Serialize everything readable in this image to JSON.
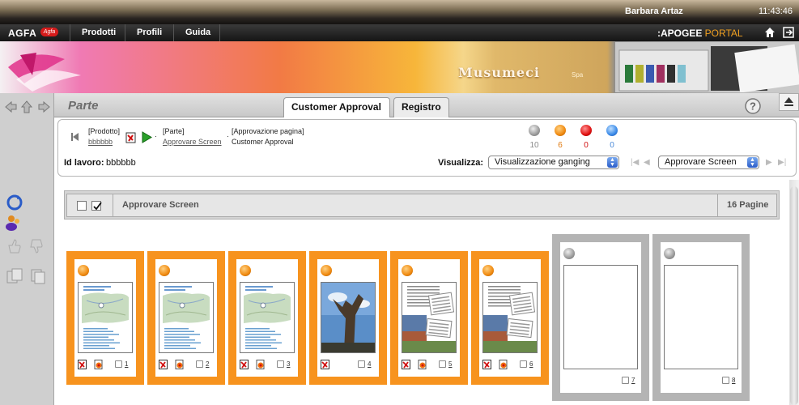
{
  "topbar": {
    "user": "Barbara Artaz",
    "time": "11:43:46"
  },
  "nav": {
    "logo": "AGFA",
    "logo_badge": "Agfa",
    "items": [
      "Prodotti",
      "Profili",
      "Guida"
    ],
    "portal_prefix": ":APOGEE",
    "portal_suffix": " PORTAL"
  },
  "banner": {
    "company": "Musumeci",
    "suffix": "Spa"
  },
  "header": {
    "title": "Parte",
    "tabs": [
      {
        "label": "Customer Approval",
        "active": true
      },
      {
        "label": "Registro",
        "active": false
      }
    ]
  },
  "breadcrumb": {
    "product_label": "[Prodotto]",
    "product_value": "bbbbbb",
    "part_label": "[Parte]",
    "part_value": "Approvare Screen",
    "approval_label": "[Approvazione pagina]",
    "approval_value": "Customer Approval"
  },
  "status_counts": [
    {
      "color": "#9a9a9a",
      "value": "10",
      "text_color": "#8a8a8a"
    },
    {
      "color": "#f08a10",
      "value": "6",
      "text_color": "#e07a10"
    },
    {
      "color": "#e01010",
      "value": "0",
      "text_color": "#d01010"
    },
    {
      "color": "#3a8ae8",
      "value": "0",
      "text_color": "#4a8ad8"
    }
  ],
  "job": {
    "label": "Id lavoro:",
    "value": "bbbbbb"
  },
  "view": {
    "label": "Visualizza:",
    "mode_selected": "Visualizzazione ganging",
    "part_selected": "Approvare Screen"
  },
  "grid": {
    "title": "Approvare Screen",
    "count": "16 Pagine"
  },
  "pages": [
    {
      "number": "1",
      "status": "orange"
    },
    {
      "number": "2",
      "status": "orange"
    },
    {
      "number": "3",
      "status": "orange"
    },
    {
      "number": "4",
      "status": "orange"
    },
    {
      "number": "5",
      "status": "orange"
    },
    {
      "number": "6",
      "status": "orange"
    },
    {
      "number": "7",
      "status": "grey"
    },
    {
      "number": "8",
      "status": "grey"
    }
  ],
  "colors": {
    "accent_orange": "#f7931e",
    "pending_grey": "#b4b4b4"
  }
}
